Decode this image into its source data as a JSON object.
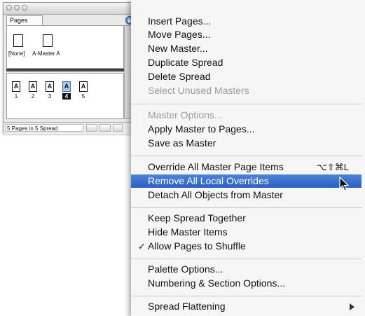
{
  "palette": {
    "tab_label": "Pages",
    "masters": [
      {
        "label": "[None]"
      },
      {
        "label": "A-Master A"
      }
    ],
    "pages": [
      {
        "prefix": "A",
        "number": "1",
        "selected": false
      },
      {
        "prefix": "A",
        "number": "2",
        "selected": false
      },
      {
        "prefix": "A",
        "number": "3",
        "selected": false
      },
      {
        "prefix": "A",
        "number": "4",
        "selected": true
      },
      {
        "prefix": "A",
        "number": "5",
        "selected": false
      }
    ],
    "status": "5 Pages in 5 Spread"
  },
  "menu": {
    "items": [
      {
        "label": "Insert Pages...",
        "disabled": false
      },
      {
        "label": "Move Pages...",
        "disabled": false
      },
      {
        "label": "New Master...",
        "disabled": false
      },
      {
        "label": "Duplicate Spread",
        "disabled": false
      },
      {
        "label": "Delete Spread",
        "disabled": false
      },
      {
        "label": "Select Unused Masters",
        "disabled": true
      },
      {
        "label": "Master Options...",
        "disabled": true
      },
      {
        "label": "Apply Master to Pages...",
        "disabled": false
      },
      {
        "label": "Save as Master",
        "disabled": false
      },
      {
        "label": "Override All Master Page Items",
        "shortcut": "⌥⇧⌘L",
        "disabled": false
      },
      {
        "label": "Remove All Local Overrides",
        "highlighted": true
      },
      {
        "label": "Detach All Objects from Master",
        "disabled": false
      },
      {
        "label": "Keep Spread Together",
        "disabled": false
      },
      {
        "label": "Hide Master Items",
        "disabled": false
      },
      {
        "label": "Allow Pages to Shuffle",
        "checked": true,
        "check_glyph": "✓"
      },
      {
        "label": "Palette Options...",
        "disabled": false
      },
      {
        "label": "Numbering & Section Options...",
        "disabled": false
      },
      {
        "label": "Spread Flattening",
        "has_submenu": true
      }
    ]
  },
  "colors": {
    "highlight": "#2b5fc2",
    "disabled_text": "#9b9b9b",
    "selected_page": "#a9c6ec"
  }
}
